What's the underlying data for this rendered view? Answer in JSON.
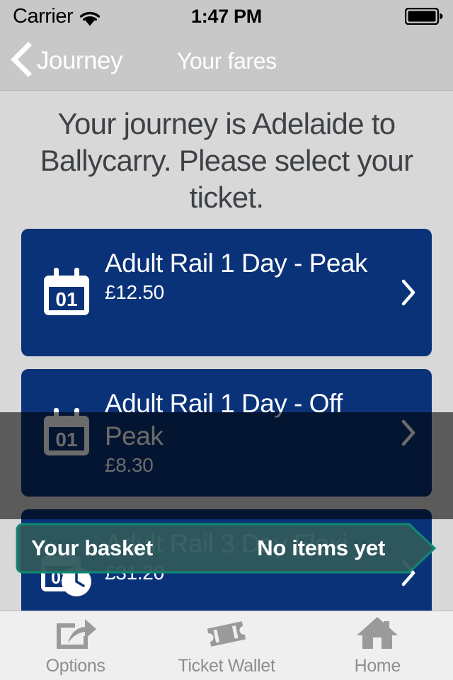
{
  "status_bar": {
    "carrier": "Carrier",
    "time": "1:47 PM",
    "wifi_icon": "wifi-icon",
    "battery_icon": "battery-full-icon"
  },
  "nav_bar": {
    "back_icon": "chevron-left-icon",
    "back_label": "Journey",
    "title": "Your fares"
  },
  "main": {
    "heading": "Your journey is Adelaide to Ballycarry. Please select your ticket.",
    "fares": [
      {
        "icon": "calendar-01-icon",
        "icon_day": "01",
        "title": "Adult Rail 1 Day - Peak",
        "price": "£12.50",
        "chevron_icon": "chevron-right-icon"
      },
      {
        "icon": "calendar-01-icon",
        "icon_day": "01",
        "title": "Adult Rail 1 Day - Off Peak",
        "price": "£8.30",
        "chevron_icon": "chevron-right-icon"
      },
      {
        "icon": "calendar-03-clock-icon",
        "icon_day": "03",
        "title": "Adult Rail 3 Day Flexi",
        "price": "£31.20",
        "chevron_icon": "chevron-right-icon"
      }
    ]
  },
  "basket": {
    "label": "Your basket",
    "status": "No items yet"
  },
  "tab_bar": {
    "tabs": [
      {
        "label": "Options",
        "icon": "share-export-icon"
      },
      {
        "label": "Ticket Wallet",
        "icon": "ticket-icon"
      },
      {
        "label": "Home",
        "icon": "home-icon"
      }
    ]
  },
  "colors": {
    "card_blue": "#0a3278",
    "basket_teal": "#0e8a73",
    "basket_fill": "#2f5a5c",
    "bar_gray": "#c8c8c8",
    "page_gray": "#d8d8d8",
    "tab_inactive": "#8e8e8e"
  }
}
